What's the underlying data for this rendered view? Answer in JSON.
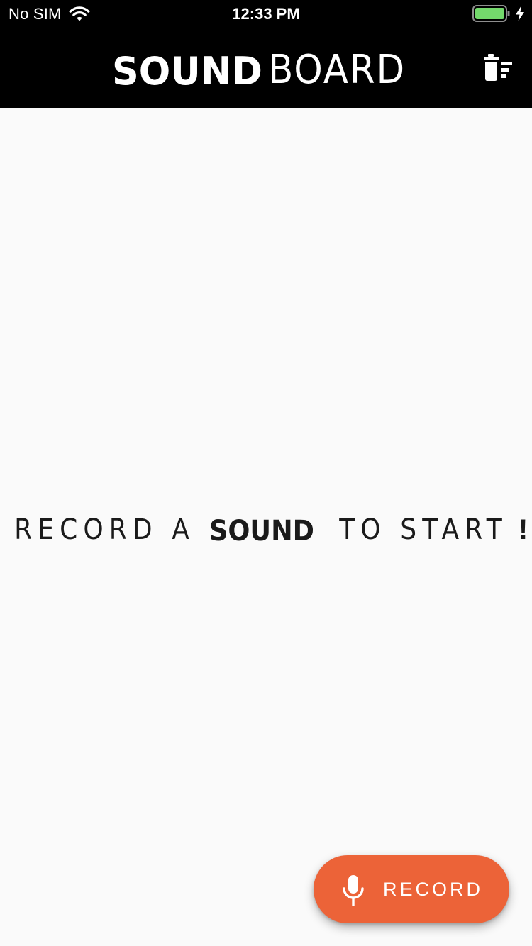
{
  "status_bar": {
    "carrier": "No SIM",
    "time": "12:33 PM",
    "battery_color": "#74d96c"
  },
  "header": {
    "logo_bold": "SOUND",
    "logo_light": "BOARD",
    "clear_icon": "trash-list-icon"
  },
  "empty_state": {
    "before": "RECORD A",
    "highlight": "SOUND",
    "after": "TO START",
    "punctuation": "!"
  },
  "record_button": {
    "label": "RECORD",
    "icon": "microphone-icon",
    "color": "#ec6338"
  },
  "colors": {
    "background": "#fafafa",
    "header": "#000000",
    "text": "#1a1a1a"
  }
}
